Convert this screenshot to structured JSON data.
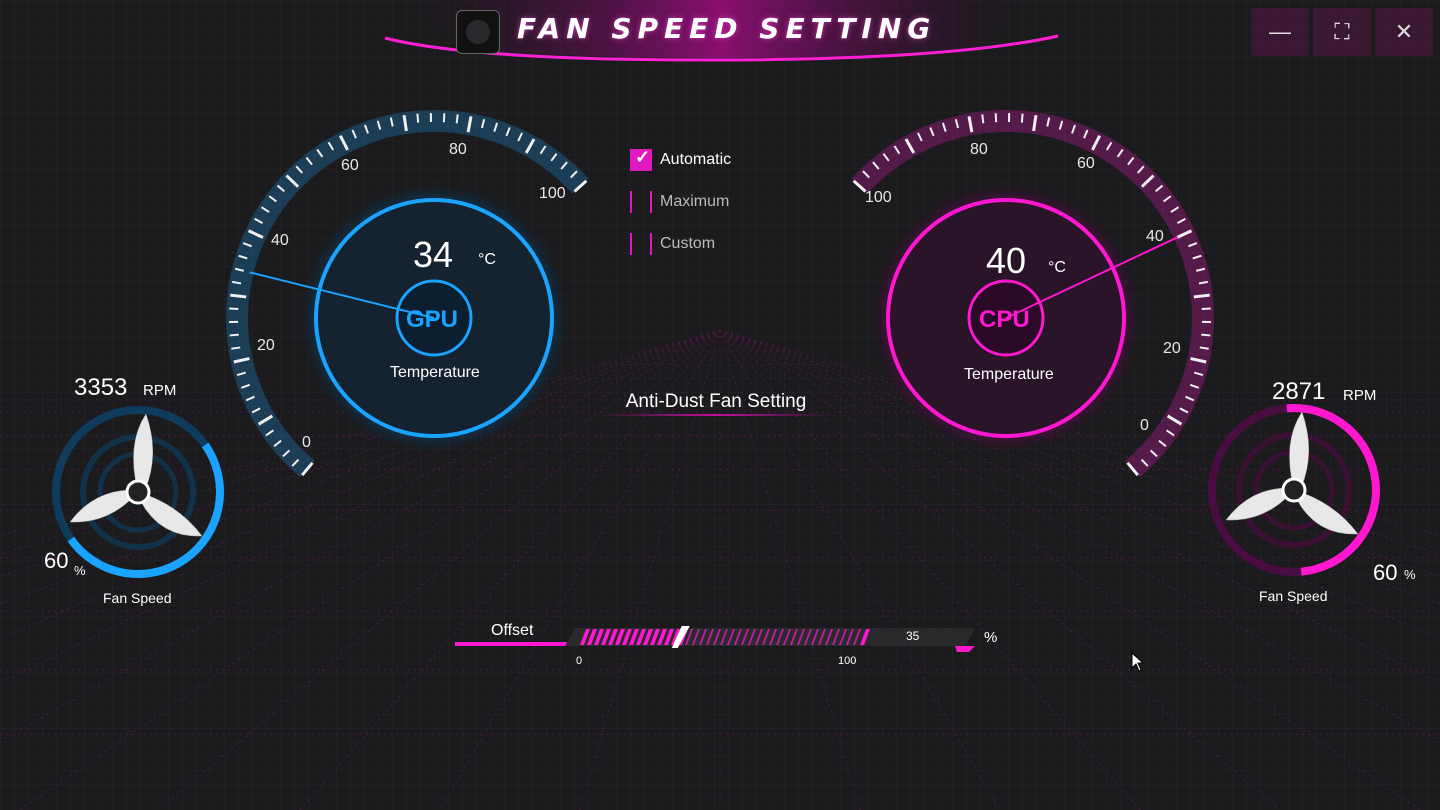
{
  "window": {
    "title": "Fan Speed Setting",
    "controls": {
      "minimize": "—",
      "maximize": "⛶",
      "close": "✕"
    }
  },
  "colors": {
    "gpu_accent": "#1aa3ff",
    "cpu_accent": "#ff18d0",
    "brand": "#e018c0",
    "background": "#1b1b1d"
  },
  "gpu": {
    "temperature": "34",
    "unit": "°C",
    "chip": "GPU",
    "label": "Temperature",
    "scale": [
      "0",
      "20",
      "40",
      "60",
      "80",
      "100"
    ],
    "needle_value": 34
  },
  "cpu": {
    "temperature": "40",
    "unit": "°C",
    "chip": "CPU",
    "label": "Temperature",
    "scale": [
      "0",
      "20",
      "40",
      "60",
      "80",
      "100"
    ],
    "needle_value": 40
  },
  "modes": [
    {
      "label": "Automatic",
      "checked": true
    },
    {
      "label": "Maximum",
      "checked": false
    },
    {
      "label": "Custom",
      "checked": false
    }
  ],
  "anti_dust": "Anti-Dust Fan Setting",
  "gpu_fan": {
    "rpm": "3353",
    "rpm_unit": "RPM",
    "percent": "60",
    "percent_unit": "%",
    "label": "Fan Speed",
    "level": 0.6
  },
  "cpu_fan": {
    "rpm": "2871",
    "rpm_unit": "RPM",
    "percent": "60",
    "percent_unit": "%",
    "label": "Fan Speed",
    "level": 0.6
  },
  "offset": {
    "label": "Offset",
    "min": "0",
    "max": "100",
    "value": "35",
    "unit": "%",
    "level": 0.35
  }
}
